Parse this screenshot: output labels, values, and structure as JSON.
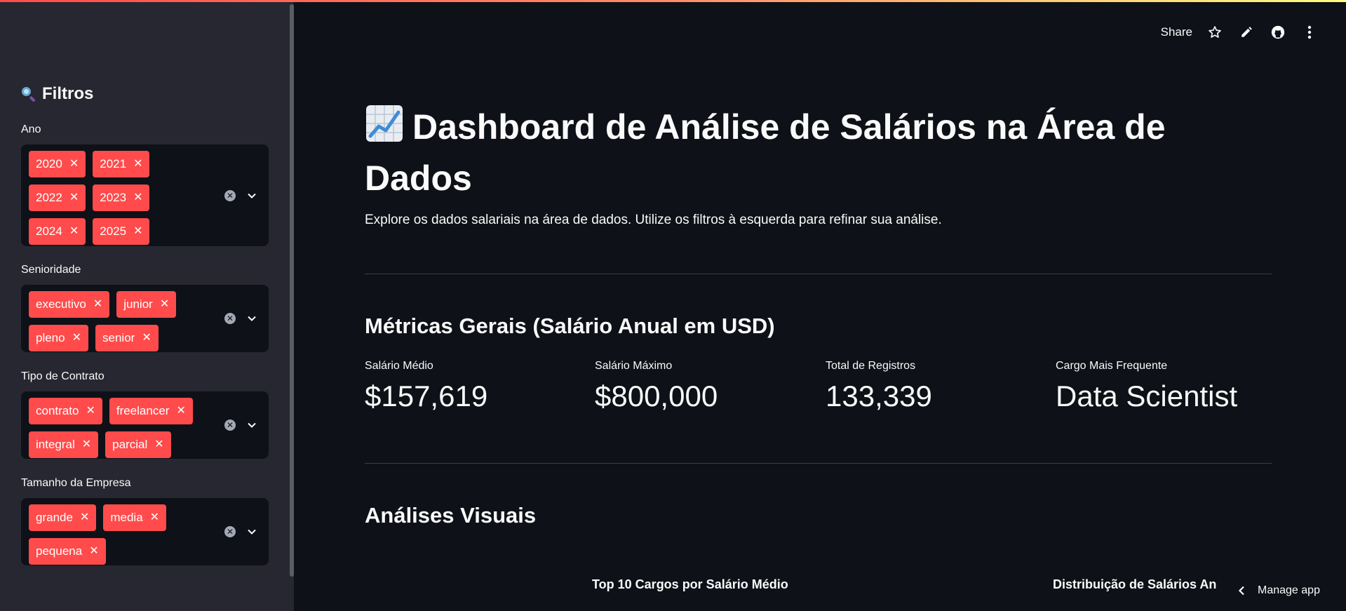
{
  "colors": {
    "accent": "#ff4b4b",
    "background": "#0e1117",
    "sidebar": "#262730"
  },
  "sidebar": {
    "title": "Filtros",
    "title_icon": "magnifier-icon",
    "filters": [
      {
        "label": "Ano",
        "tags": [
          "2020",
          "2021",
          "2022",
          "2023",
          "2024",
          "2025"
        ]
      },
      {
        "label": "Senioridade",
        "tags": [
          "executivo",
          "junior",
          "pleno",
          "senior"
        ]
      },
      {
        "label": "Tipo de Contrato",
        "tags": [
          "contrato",
          "freelancer",
          "integral",
          "parcial"
        ]
      },
      {
        "label": "Tamanho da Empresa",
        "tags": [
          "grande",
          "media",
          "pequena"
        ]
      }
    ]
  },
  "topbar": {
    "share_label": "Share",
    "icons": [
      "star-icon",
      "edit-icon",
      "github-icon",
      "more-icon"
    ]
  },
  "main": {
    "title": "Dashboard de Análise de Salários na Área de Dados",
    "subtitle": "Explore os dados salariais na área de dados. Utilize os filtros à esquerda para refinar sua análise.",
    "metrics_heading": "Métricas Gerais (Salário Anual em USD)",
    "metrics": [
      {
        "label": "Salário Médio",
        "value": "$157,619"
      },
      {
        "label": "Salário Máximo",
        "value": "$800,000"
      },
      {
        "label": "Total de Registros",
        "value": "133,339"
      },
      {
        "label": "Cargo Mais Frequente",
        "value": "Data Scientist"
      }
    ],
    "visual_heading": "Análises Visuais",
    "chart_titles": [
      "Top 10 Cargos por Salário Médio",
      "Distribuição de Salários An"
    ]
  },
  "manage_app": "Manage app"
}
